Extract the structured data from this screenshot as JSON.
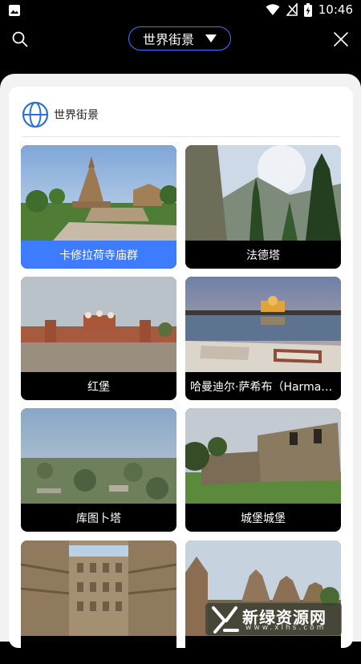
{
  "status": {
    "time": "10:46"
  },
  "header": {
    "title": "世界街景"
  },
  "panel": {
    "title": "世界街景"
  },
  "places": [
    {
      "name": "卡修拉荷寺庙群",
      "selected": true
    },
    {
      "name": "法德塔",
      "selected": false
    },
    {
      "name": "红堡",
      "selected": false
    },
    {
      "name": "哈曼迪尔·萨希布（Harmandir Sahib）",
      "selected": false
    },
    {
      "name": "库图卜塔",
      "selected": false
    },
    {
      "name": "城堡城堡",
      "selected": false
    },
    {
      "name": "",
      "selected": false
    },
    {
      "name": "",
      "selected": false
    }
  ],
  "watermark": {
    "text": "新绿资源网",
    "url": "www.xlhs.com"
  },
  "colors": {
    "accent": "#3d7bff",
    "pill_border": "#3b78ff"
  }
}
